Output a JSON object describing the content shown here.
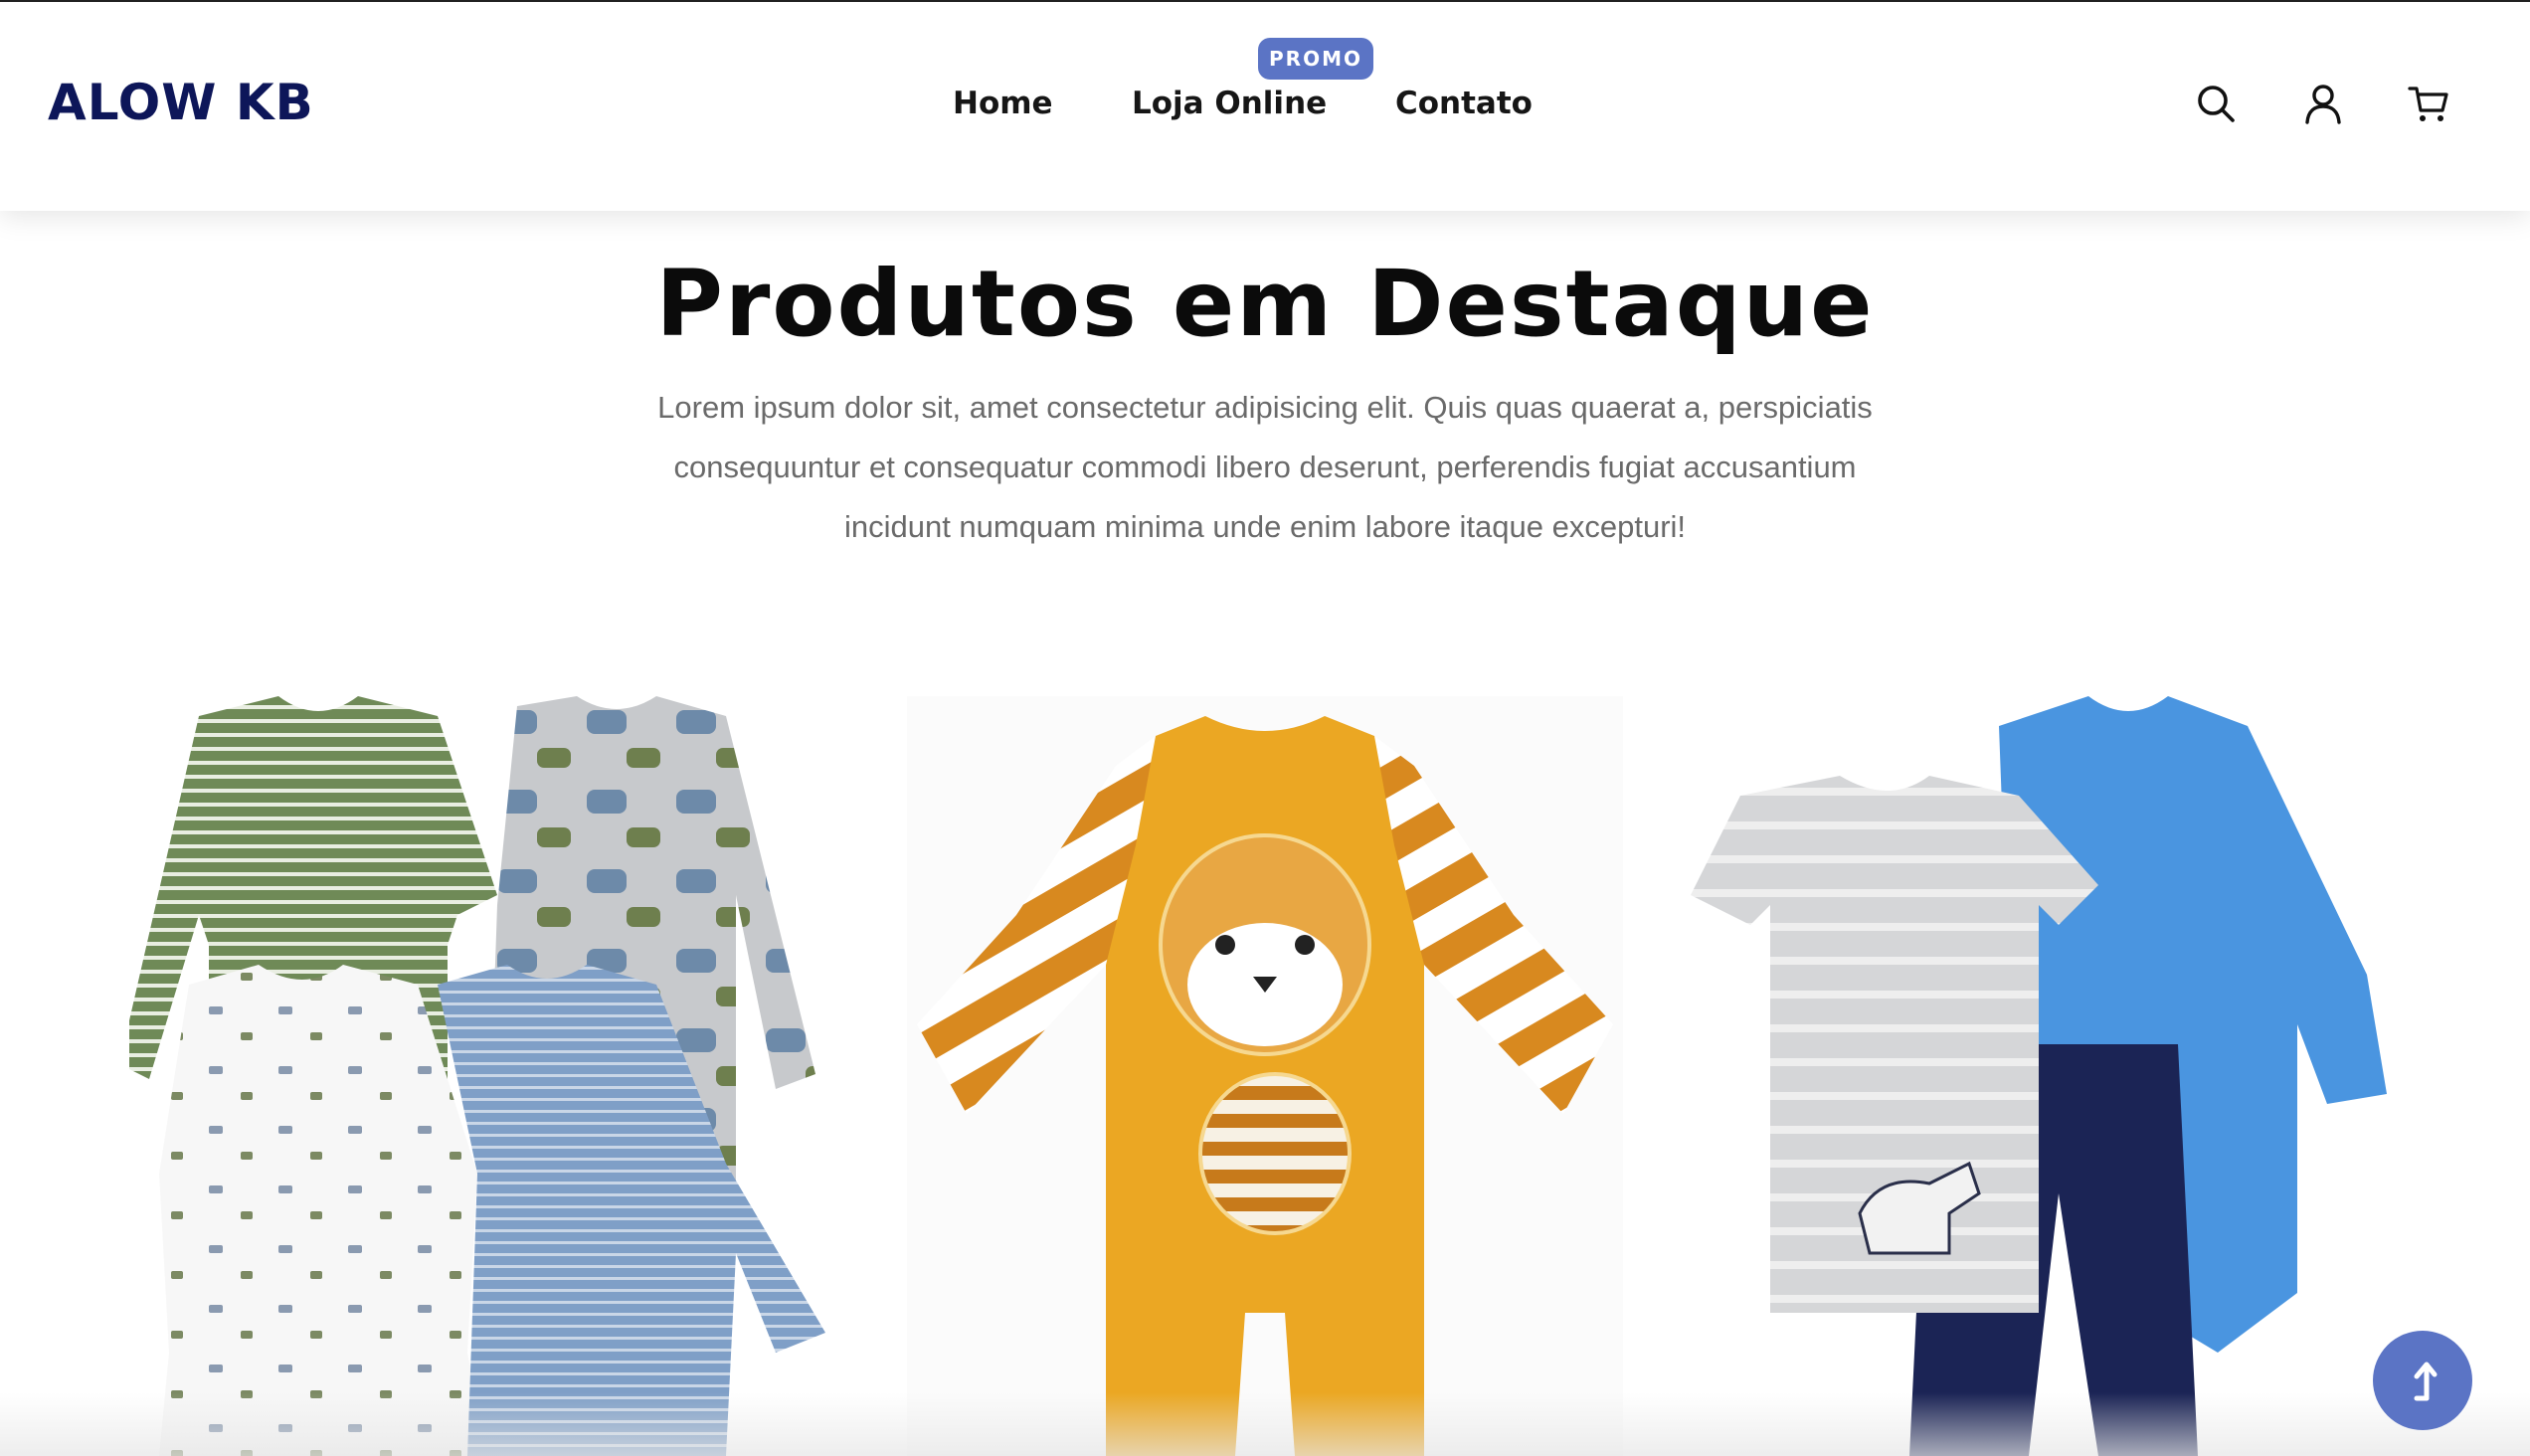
{
  "brand": {
    "name": "ALOW KB"
  },
  "nav": {
    "items": [
      {
        "label": "Home"
      },
      {
        "label": "Loja Online",
        "badge": "PROMO"
      },
      {
        "label": "Contato"
      }
    ]
  },
  "header_icons": [
    "search-icon",
    "user-icon",
    "cart-icon"
  ],
  "hero": {
    "title": "Produtos em Destaque",
    "subtitle_lines": [
      "Lorem ipsum dolor sit, amet consectetur adipisicing elit. Quis quas quaerat a, perspiciatis",
      "consequuntur et consequatur commodi libero deserunt, perferendis fugiat accusantium",
      "incidunt numquam minima unde enim labore itaque excepturi!"
    ]
  },
  "products": [
    {
      "image": "pack of four long-sleeve baby bodysuits"
    },
    {
      "image": "orange tiger velour baby footie"
    },
    {
      "image": "dinosaur print bodysuit, t-shirt and navy pants set"
    }
  ],
  "colors": {
    "brand": "#0d1659",
    "accent": "#5b74c5",
    "text": "#161616",
    "muted": "#6a6a6a"
  },
  "scroll_top": {
    "icon": "arrow-up-icon"
  }
}
